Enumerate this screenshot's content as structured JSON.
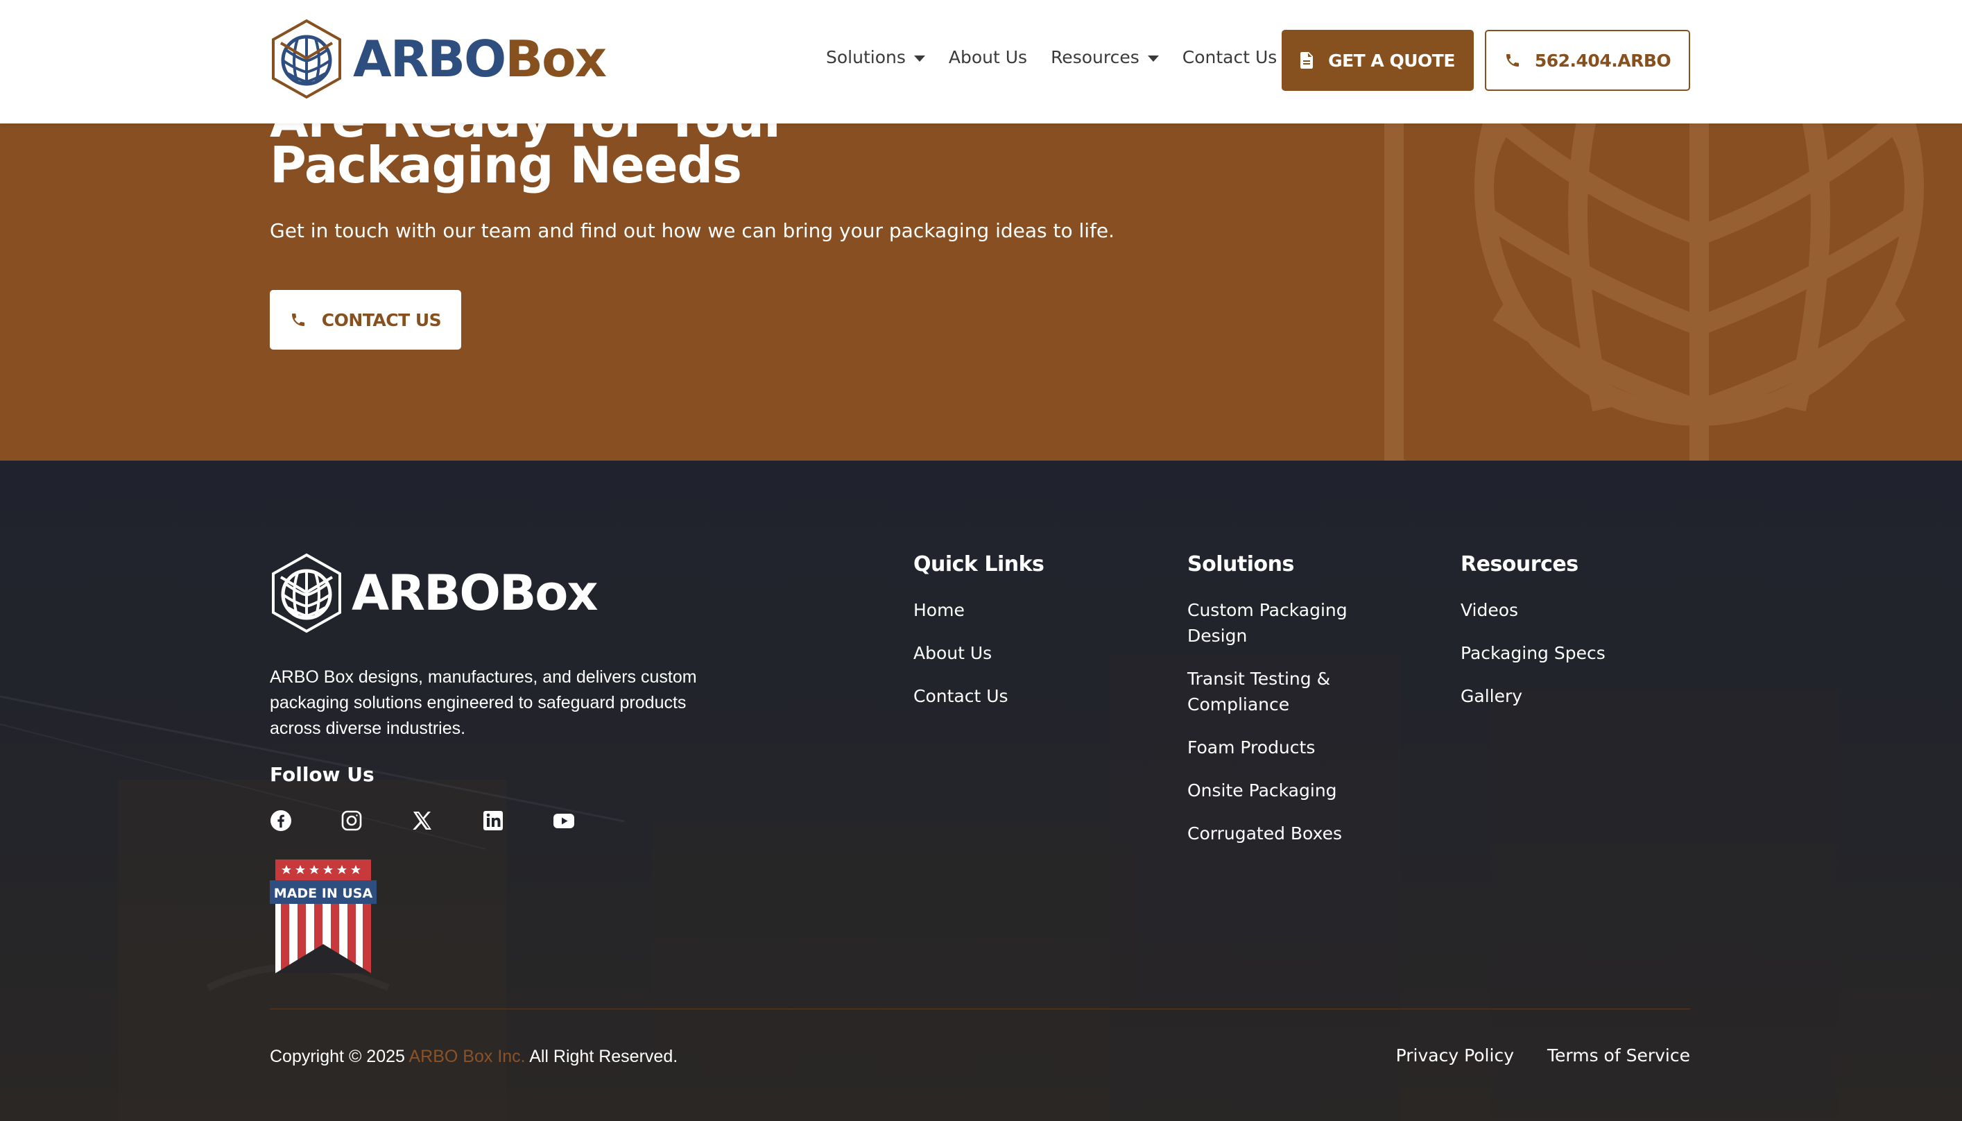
{
  "header": {
    "logo": {
      "part1": "ARBO",
      "part2": "Box"
    },
    "nav": [
      {
        "label": "Solutions",
        "has_dropdown": true
      },
      {
        "label": "About Us",
        "has_dropdown": false
      },
      {
        "label": "Resources",
        "has_dropdown": true
      },
      {
        "label": "Contact Us",
        "has_dropdown": false
      }
    ],
    "quote_button": {
      "label": "GET A QUOTE",
      "icon": "document-icon"
    },
    "phone_button": {
      "label": "562.404.ARBO",
      "icon": "phone-icon"
    }
  },
  "hero": {
    "title_line_partial": "Are Ready for Your",
    "title_line": "Packaging Needs",
    "subtitle": "Get in touch with our team and find out how we can bring your packaging ideas to life.",
    "cta": {
      "label": "CONTACT US",
      "icon": "phone-icon"
    }
  },
  "footer": {
    "logo": {
      "text": "ARBOBox"
    },
    "about": "ARBO Box designs, manufactures, and delivers custom packaging solutions engineered to safeguard products across diverse industries.",
    "follow_title": "Follow Us",
    "socials": [
      "facebook-icon",
      "instagram-icon",
      "x-icon",
      "linkedin-icon",
      "youtube-icon"
    ],
    "badge": {
      "text": "MADE IN USA"
    },
    "quick_links": {
      "title": "Quick Links",
      "items": [
        "Home",
        "About Us",
        "Contact Us"
      ]
    },
    "solutions": {
      "title": "Solutions",
      "items": [
        "Custom Packaging Design",
        "Transit Testing & Compliance",
        "Foam Products",
        "Onsite Packaging",
        "Corrugated Boxes"
      ]
    },
    "resources": {
      "title": "Resources",
      "items": [
        "Videos",
        "Packaging Specs",
        "Gallery"
      ]
    },
    "copyright": {
      "prefix": "Copyright © 2025 ",
      "brand": "ARBO Box Inc.",
      "suffix": " All Right Reserved."
    },
    "legal": [
      "Privacy Policy",
      "Terms of Service"
    ]
  },
  "colors": {
    "brand_brown": "#87501f",
    "brand_blue": "#2f4e80",
    "footer_bg": "#20232d"
  }
}
